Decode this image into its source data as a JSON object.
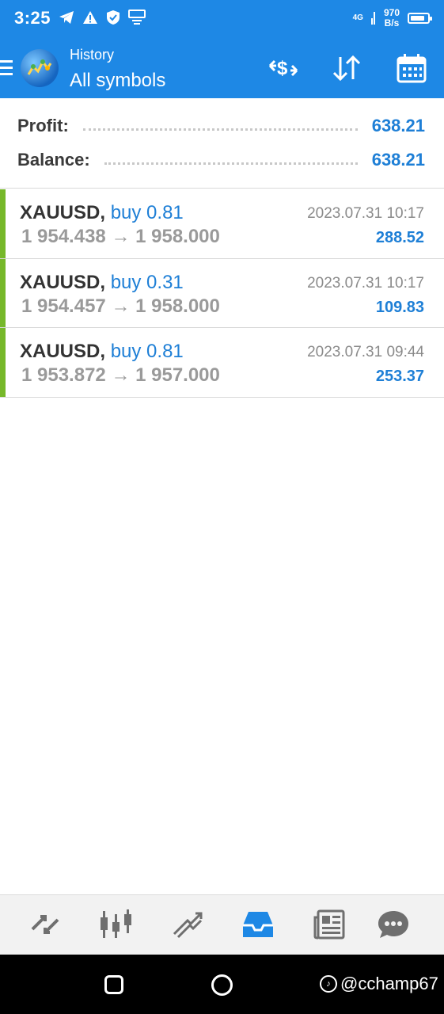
{
  "status_bar": {
    "time": "3:25",
    "network_speed_value": "970",
    "network_speed_unit": "B/s",
    "network_type": "4G",
    "battery_level": 0.85,
    "icons": [
      "telegram-icon",
      "warning-icon",
      "shield-icon",
      "message-icon",
      "signal-icon",
      "battery-icon"
    ]
  },
  "header": {
    "subtitle": "History",
    "title": "All symbols",
    "actions": [
      "currency-exchange-icon",
      "sort-icon",
      "calendar-icon"
    ]
  },
  "summary": {
    "profit_label": "Profit:",
    "profit_value": "638.21",
    "balance_label": "Balance:",
    "balance_value": "638.21"
  },
  "trades": [
    {
      "symbol": "XAUUSD,",
      "direction": "buy 0.81",
      "prices": "1 954.438 → 1 958.000",
      "time": "2023.07.31 10:17",
      "profit": "288.52"
    },
    {
      "symbol": "XAUUSD,",
      "direction": "buy 0.31",
      "prices": "1 954.457 → 1 958.000",
      "time": "2023.07.31 10:17",
      "profit": "109.83"
    },
    {
      "symbol": "XAUUSD,",
      "direction": "buy 0.81",
      "prices": "1 953.872 → 1 957.000",
      "time": "2023.07.31 09:44",
      "profit": "253.37"
    }
  ],
  "tabbar": {
    "tabs": [
      "quotes-icon",
      "chart-icon",
      "trade-icon",
      "history-icon",
      "news-icon",
      "chat-icon"
    ],
    "active": "history-icon"
  },
  "system_nav": {
    "watermark": "@cchamp67"
  },
  "colors": {
    "primary": "#1e88e5",
    "value_blue": "#1e7fd6",
    "buy_marker": "#76b82a"
  }
}
